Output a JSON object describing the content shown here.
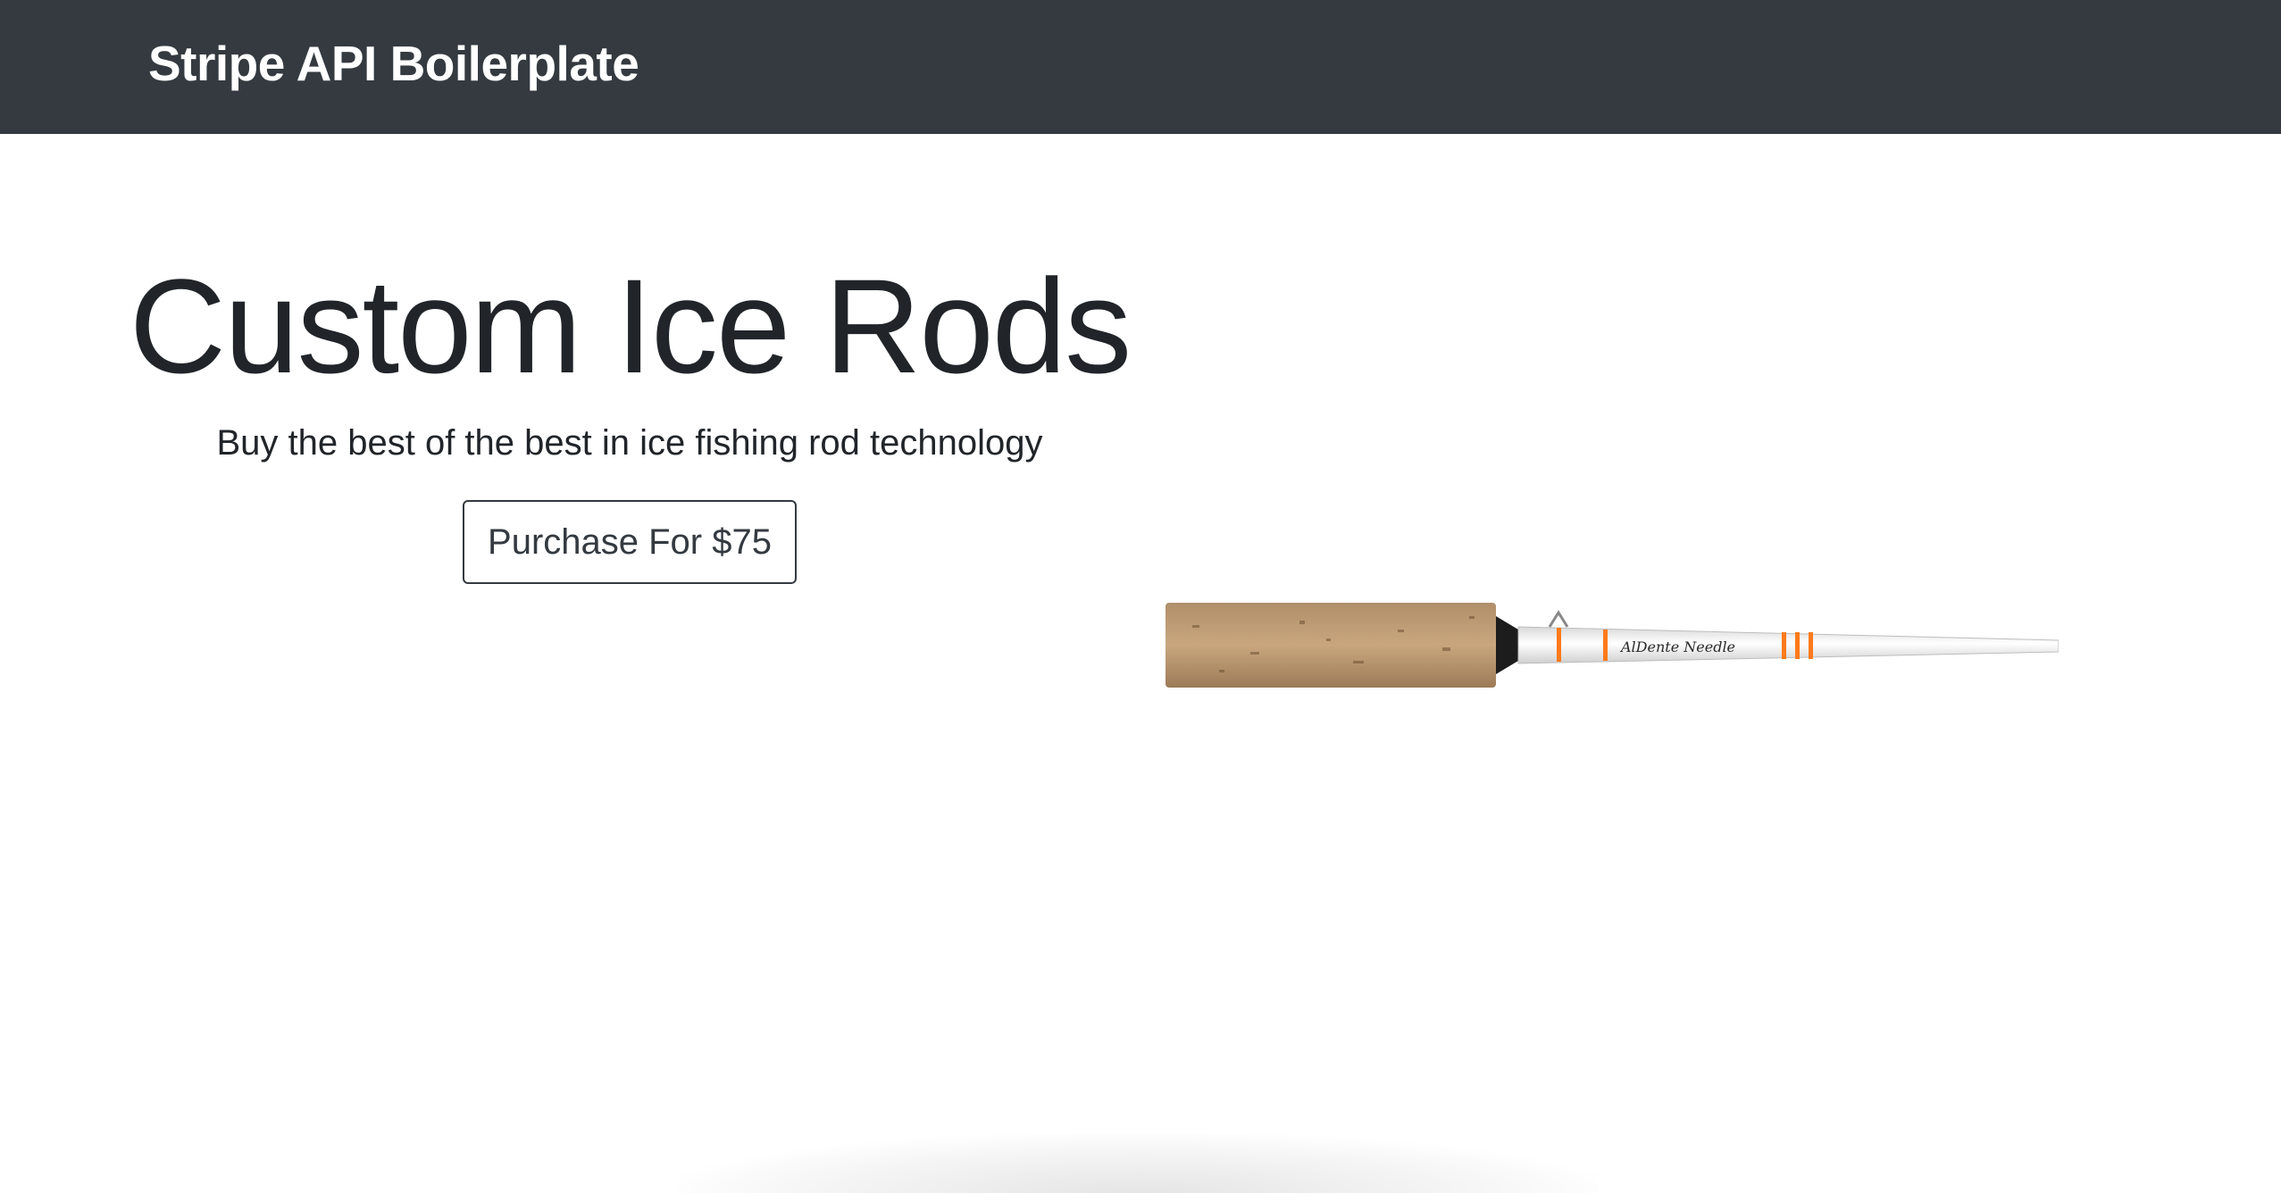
{
  "navbar": {
    "brand": "Stripe API Boilerplate",
    "background": "#343a40"
  },
  "hero": {
    "title": "Custom Ice Rods",
    "subtitle": "Buy the best of the best in ice fishing rod technology",
    "purchase_button": "Purchase For $75"
  },
  "product": {
    "image_icon": "ice-fishing-rod-image",
    "rod_label": "AlDente Needle"
  }
}
